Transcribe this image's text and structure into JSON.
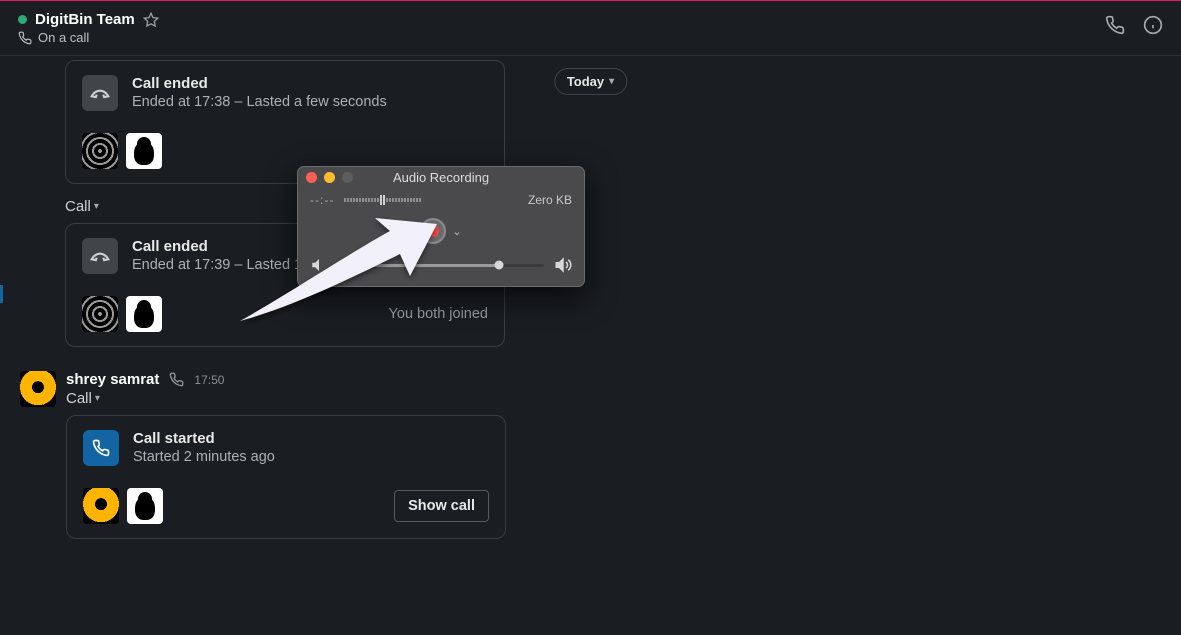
{
  "header": {
    "channel_name": "DigitBin Team",
    "subtitle": "On a call"
  },
  "date_divider": "Today",
  "call1": {
    "title": "Call ended",
    "subtitle": "Ended at 17:38 – Lasted a few seconds"
  },
  "call2_label": "Call",
  "call2": {
    "title": "Call ended",
    "subtitle": "Ended at 17:39 – Lasted 1 minute",
    "joined_text": "You both joined"
  },
  "msg": {
    "user": "shrey samrat",
    "time": "17:50",
    "call_label": "Call"
  },
  "call3": {
    "title": "Call started",
    "subtitle": "Started 2 minutes ago",
    "show_call": "Show call"
  },
  "audio_window": {
    "title": "Audio Recording",
    "elapsed": "--:--",
    "size": "Zero KB"
  }
}
